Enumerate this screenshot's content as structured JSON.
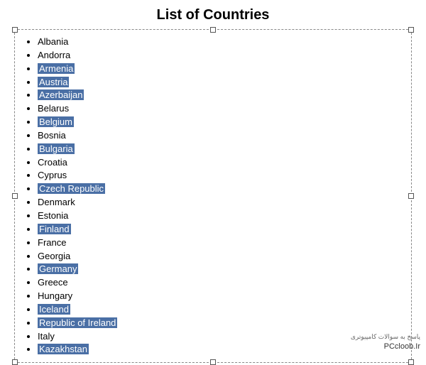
{
  "title": "List of Countries",
  "countries": [
    {
      "name": "Albania",
      "highlighted": false
    },
    {
      "name": "Andorra",
      "highlighted": false
    },
    {
      "name": "Armenia",
      "highlighted": true
    },
    {
      "name": "Austria",
      "highlighted": true
    },
    {
      "name": "Azerbaijan",
      "highlighted": true
    },
    {
      "name": "Belarus",
      "highlighted": false
    },
    {
      "name": "Belgium",
      "highlighted": true
    },
    {
      "name": "Bosnia",
      "highlighted": false
    },
    {
      "name": "Bulgaria",
      "highlighted": true
    },
    {
      "name": "Croatia",
      "highlighted": false
    },
    {
      "name": "Cyprus",
      "highlighted": false
    },
    {
      "name": "Czech Republic",
      "highlighted": true
    },
    {
      "name": "Denmark",
      "highlighted": false
    },
    {
      "name": "Estonia",
      "highlighted": false
    },
    {
      "name": "Finland",
      "highlighted": true
    },
    {
      "name": "France",
      "highlighted": false
    },
    {
      "name": "Georgia",
      "highlighted": false
    },
    {
      "name": "Germany",
      "highlighted": true
    },
    {
      "name": "Greece",
      "highlighted": false
    },
    {
      "name": "Hungary",
      "highlighted": false
    },
    {
      "name": "Iceland",
      "highlighted": true
    },
    {
      "name": "Republic of Ireland",
      "highlighted": true
    },
    {
      "name": "Italy",
      "highlighted": false
    },
    {
      "name": "Kazakhstan",
      "highlighted": true
    }
  ],
  "watermark": "PCcloob.Ir",
  "watermark_persian": "پاسخ به سوالات کامپیوتری"
}
